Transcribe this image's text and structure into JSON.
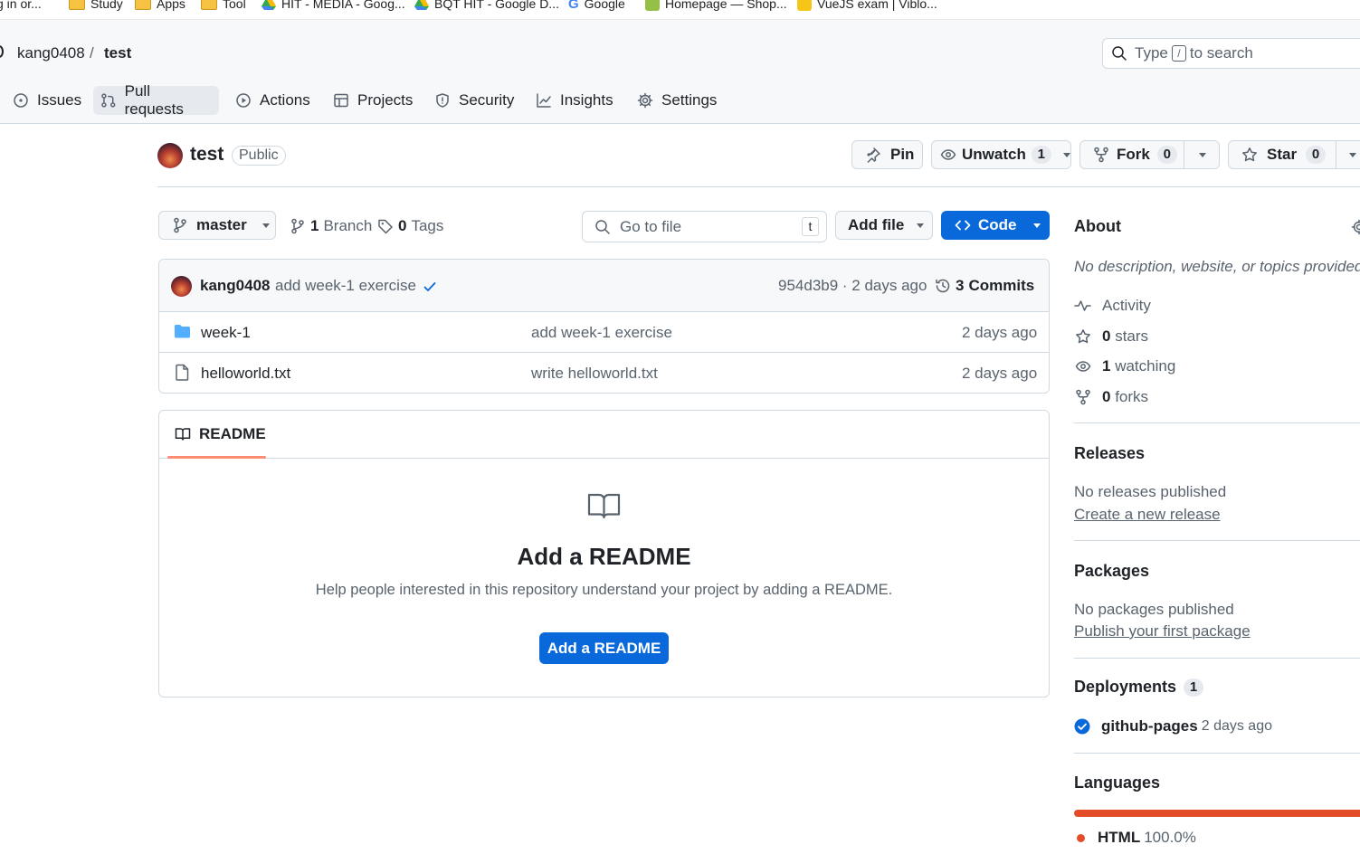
{
  "bookmarks": [
    {
      "label": "g in or...",
      "icon": "page-icon"
    },
    {
      "label": "Study",
      "icon": "folder-icon"
    },
    {
      "label": "Apps",
      "icon": "folder-icon"
    },
    {
      "label": "Tool",
      "icon": "folder-icon"
    },
    {
      "label": "HIT - MEDIA - Goog...",
      "icon": "google-drive-icon"
    },
    {
      "label": "BQT HIT - Google D...",
      "icon": "google-drive-icon"
    },
    {
      "label": "Google",
      "icon": "google-icon"
    },
    {
      "label": "Homepage — Shop...",
      "icon": "shopify-icon"
    },
    {
      "label": "VueJS exam | Viblo...",
      "icon": "viblo-icon"
    }
  ],
  "header": {
    "owner": "kang0408",
    "separator": "/",
    "repo": "test",
    "search_placeholder_pre": "Type",
    "search_key": "/",
    "search_placeholder_post": "to search"
  },
  "tabs": [
    {
      "label": "Issues",
      "icon": "issue-icon"
    },
    {
      "label": "Pull requests",
      "icon": "pull-request-icon",
      "selected": true
    },
    {
      "label": "Actions",
      "icon": "play-icon"
    },
    {
      "label": "Projects",
      "icon": "table-icon"
    },
    {
      "label": "Security",
      "icon": "shield-icon"
    },
    {
      "label": "Insights",
      "icon": "graph-icon"
    },
    {
      "label": "Settings",
      "icon": "gear-icon"
    }
  ],
  "repo": {
    "name": "test",
    "visibility": "Public",
    "pin_label": "Pin",
    "unwatch_label": "Unwatch",
    "watch_count": "1",
    "fork_label": "Fork",
    "fork_count": "0",
    "star_label": "Star",
    "star_count": "0"
  },
  "toolbar": {
    "branch": "master",
    "branch_count": "1",
    "branch_label": "Branch",
    "tag_count": "0",
    "tag_label": "Tags",
    "go_to_file": "Go to file",
    "go_to_file_key": "t",
    "add_file": "Add file",
    "code": "Code"
  },
  "commit": {
    "author": "kang0408",
    "message": "add week-1 exercise",
    "sha_time": "954d3b9 · 2 days ago",
    "commits_count": "3",
    "commits_label": "Commits"
  },
  "files": [
    {
      "name": "week-1",
      "type": "folder",
      "message": "add week-1 exercise",
      "time": "2 days ago"
    },
    {
      "name": "helloworld.txt",
      "type": "file",
      "message": "write helloworld.txt",
      "time": "2 days ago"
    }
  ],
  "readme": {
    "tab_label": "README",
    "title": "Add a README",
    "description": "Help people interested in this repository understand your project by adding a README.",
    "button": "Add a README"
  },
  "about": {
    "title": "About",
    "description": "No description, website, or topics provided.",
    "activity": "Activity",
    "stars_count": "0",
    "stars_label": "stars",
    "watching_count": "1",
    "watching_label": "watching",
    "forks_count": "0",
    "forks_label": "forks"
  },
  "releases": {
    "title": "Releases",
    "text": "No releases published",
    "link": "Create a new release"
  },
  "packages": {
    "title": "Packages",
    "text": "No packages published",
    "link": "Publish your first package"
  },
  "deployments": {
    "title": "Deployments",
    "count": "1",
    "env": "github-pages",
    "time": "2 days ago"
  },
  "languages": {
    "title": "Languages",
    "items": [
      {
        "name": "HTML",
        "percent": "100.0%",
        "color": "#e34c26"
      }
    ]
  },
  "colors": {
    "accent": "#0969da",
    "primary_button": "#0969da",
    "html_lang": "#e34c26",
    "success": "#1f883d"
  }
}
